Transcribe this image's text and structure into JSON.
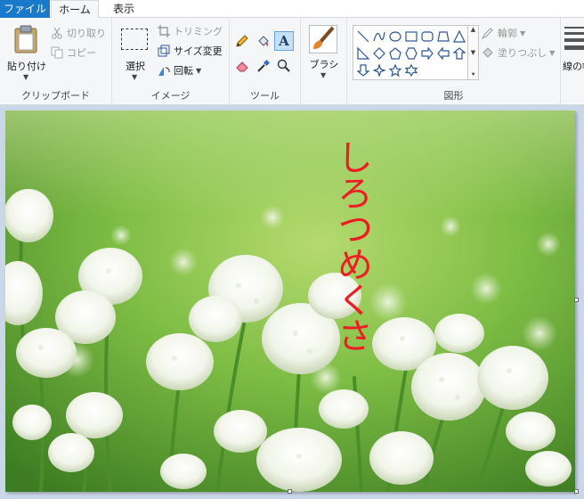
{
  "tabs": {
    "file": "ファイル",
    "home": "ホーム",
    "view": "表示"
  },
  "clipboard": {
    "paste": "貼り付け",
    "cut": "切り取り",
    "copy": "コピー",
    "group": "クリップボード"
  },
  "image": {
    "select": "選択",
    "crop": "トリミング",
    "resize": "サイズ変更",
    "rotate": "回転",
    "group": "イメージ"
  },
  "tools": {
    "group": "ツール"
  },
  "brush": {
    "label": "ブラシ"
  },
  "shapes": {
    "outline": "輪郭",
    "fill": "塗りつぶし",
    "group": "図形"
  },
  "size": {
    "label": "線の幅"
  },
  "canvas": {
    "text": "しろつめくさ",
    "text_color": "#ee1c24"
  },
  "colors": {
    "accent": "#1979ca",
    "ribbon_bg": "#f5f6f7",
    "workspace_bg": "#c9d7e8"
  }
}
